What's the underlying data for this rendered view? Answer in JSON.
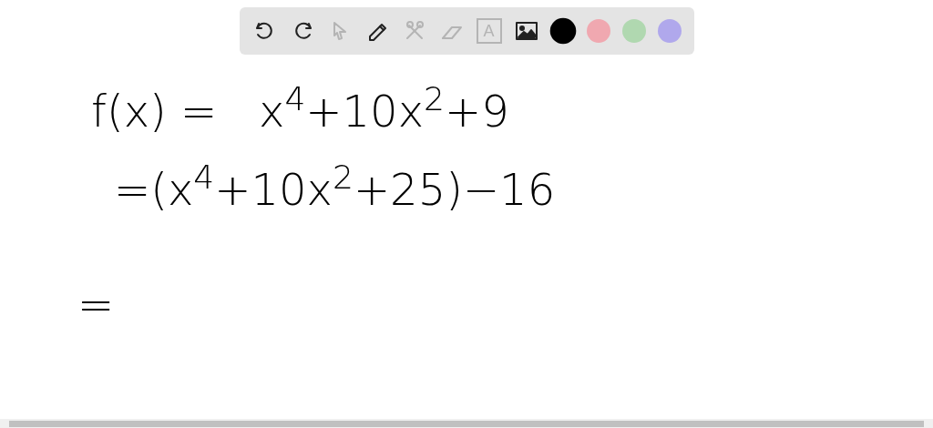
{
  "toolbar": {
    "tools": [
      {
        "kind": "undo",
        "disabled": false
      },
      {
        "kind": "redo",
        "disabled": false
      },
      {
        "kind": "select",
        "disabled": true
      },
      {
        "kind": "pen",
        "disabled": false
      },
      {
        "kind": "tools",
        "disabled": true
      },
      {
        "kind": "eraser",
        "disabled": true
      },
      {
        "kind": "text",
        "label": "A",
        "disabled": true
      },
      {
        "kind": "image",
        "disabled": false
      }
    ],
    "colors": [
      {
        "color": "#000000",
        "selected": true
      },
      {
        "color": "#f0a8b0",
        "selected": false
      },
      {
        "color": "#b0d8b0",
        "selected": false
      },
      {
        "color": "#b0a8ec",
        "selected": false
      }
    ]
  },
  "board": {
    "lines": [
      "f(x) =   x$^{4}$+10x$^{2}$+9",
      "=(x$^{4}$+10x$^{2}$+25)−16",
      "="
    ]
  }
}
